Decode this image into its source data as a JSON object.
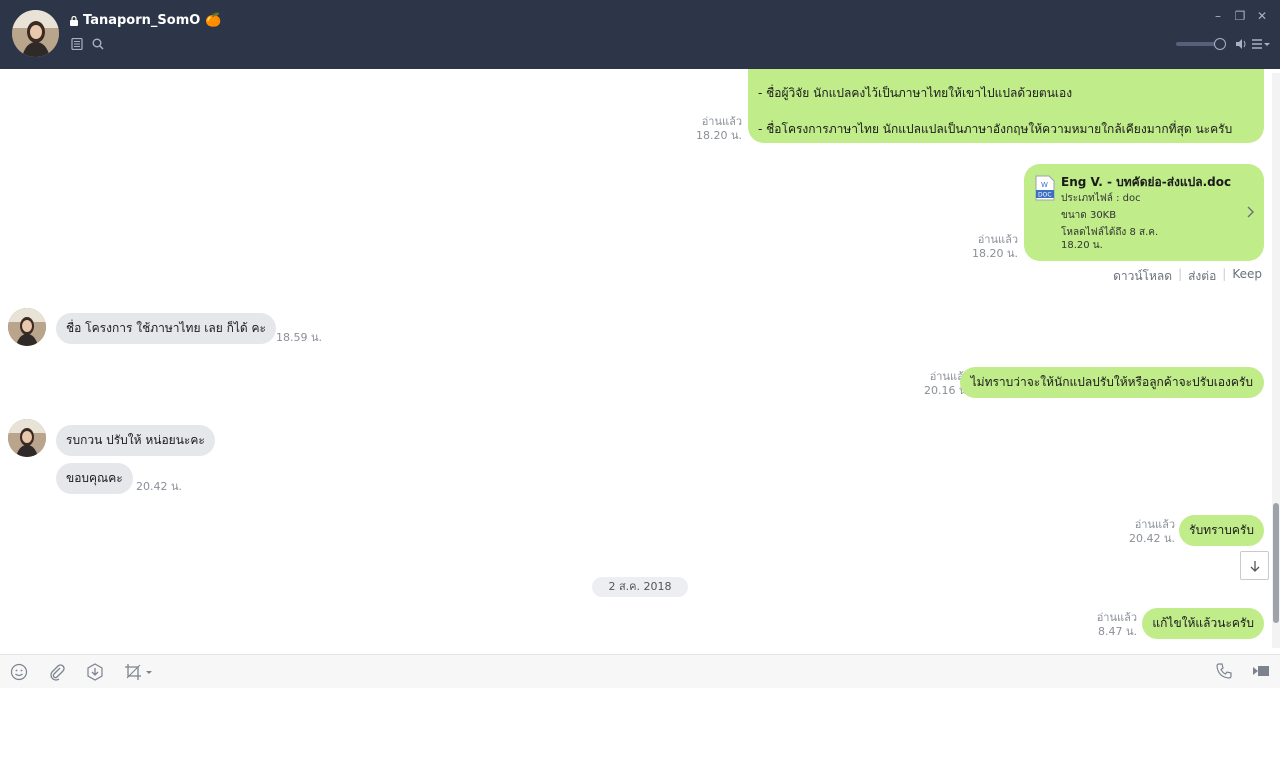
{
  "header": {
    "contact_name": "Tanaporn_SomO",
    "title_emoji": "🍊",
    "icons": [
      "lock-icon",
      "notes-icon",
      "search-icon"
    ],
    "window_controls": [
      "minimize-icon",
      "restore-icon",
      "close-icon"
    ]
  },
  "messages": {
    "m1": {
      "line1": "- ชื่อผู้วิจัย นักแปลคงไว้เป็นภาษาไทยให้เขาไปแปลด้วยตนเอง",
      "line2": "- ชื่อโครงการภาษาไทย นักแปลแปลเป็นภาษาอังกฤษให้ความหมายใกล้เคียงมากที่สุด นะครับ",
      "read": "อ่านแล้ว",
      "time": "18.20 น."
    },
    "file": {
      "name": "Eng V. - บทคัดย่อ-ส่งแปล.doc",
      "type": "ประเภทไฟล์ : doc",
      "size": "ขนาด 30KB",
      "expiry": "โหลดไฟล์ได้ถึง 8 ส.ค.",
      "expiry_time": "18.20 น.",
      "icon_label": "DOC",
      "read": "อ่านแล้ว",
      "time": "18.20 น.",
      "actions": {
        "download": "ดาวน์โหลด",
        "forward": "ส่งต่อ",
        "keep": "Keep"
      }
    },
    "m3": {
      "text": "ชื่อ โครงการ ใช้ภาษาไทย เลย ก็ได้ คะ",
      "time": "18.59 น."
    },
    "m4": {
      "text": "ไม่ทราบว่าจะให้นักแปลปรับให้หรือลูกค้าจะปรับเองครับ",
      "read": "อ่านแล้ว",
      "time": "20.16 น."
    },
    "m5": {
      "text": "รบกวน ปรับให้ หน่อยนะคะ"
    },
    "m6": {
      "text": "ขอบคุณคะ",
      "time": "20.42 น."
    },
    "m7": {
      "text": "รับทราบครับ",
      "read": "อ่านแล้ว",
      "time": "20.42 น."
    },
    "date_divider": "2 ส.ค. 2018",
    "m8": {
      "text": "แก้ไขให้แล้วนะครับ",
      "read": "อ่านแล้ว",
      "time": "8.47 น."
    }
  },
  "toolbar": {
    "left_icons": [
      "emoji-icon",
      "attach-icon",
      "keep-icon",
      "screenshot-icon"
    ],
    "right_icons": [
      "call-icon",
      "video-call-icon"
    ]
  }
}
